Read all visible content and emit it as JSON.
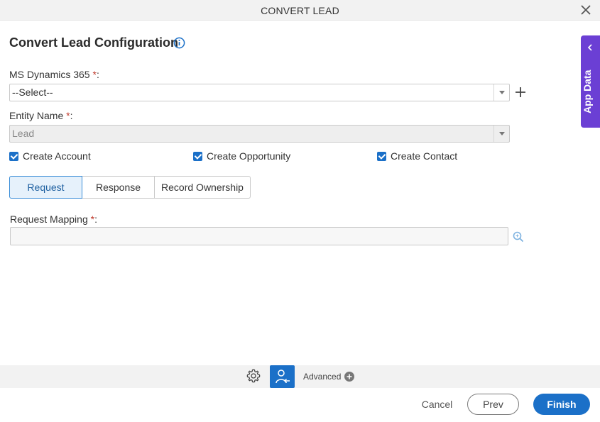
{
  "window": {
    "title": "CONVERT LEAD",
    "close_icon": "close-icon"
  },
  "form": {
    "heading": "Convert Lead Configuration",
    "info_icon": "info-icon",
    "ms_dynamics": {
      "label": "MS Dynamics 365",
      "required_mark": "*",
      "colon": ":",
      "value": "--Select--",
      "add_icon": "plus-icon"
    },
    "entity_name": {
      "label": "Entity Name",
      "required_mark": "*",
      "colon": ":",
      "value": "Lead"
    },
    "checkboxes": [
      {
        "label": "Create Account",
        "checked": true
      },
      {
        "label": "Create Opportunity",
        "checked": true
      },
      {
        "label": "Create Contact",
        "checked": true
      }
    ],
    "tabs": [
      {
        "label": "Request",
        "active": true
      },
      {
        "label": "Response",
        "active": false
      },
      {
        "label": "Record Ownership",
        "active": false
      }
    ],
    "request_mapping": {
      "label": "Request Mapping",
      "required_mark": "*",
      "colon": ":",
      "value": "",
      "lookup_icon": "lookup-icon"
    }
  },
  "side_panel": {
    "label": "App Data",
    "icon": "chevron-left-icon"
  },
  "toolbar": {
    "settings_icon": "gear-icon",
    "user_icon": "user-convert-icon",
    "advanced_label": "Advanced",
    "advanced_icon": "plus-circle-icon"
  },
  "footer": {
    "cancel_label": "Cancel",
    "prev_label": "Prev",
    "finish_label": "Finish"
  },
  "colors": {
    "primary": "#1b70c8",
    "side_panel": "#6b3fd4",
    "required": "#c0392b"
  }
}
